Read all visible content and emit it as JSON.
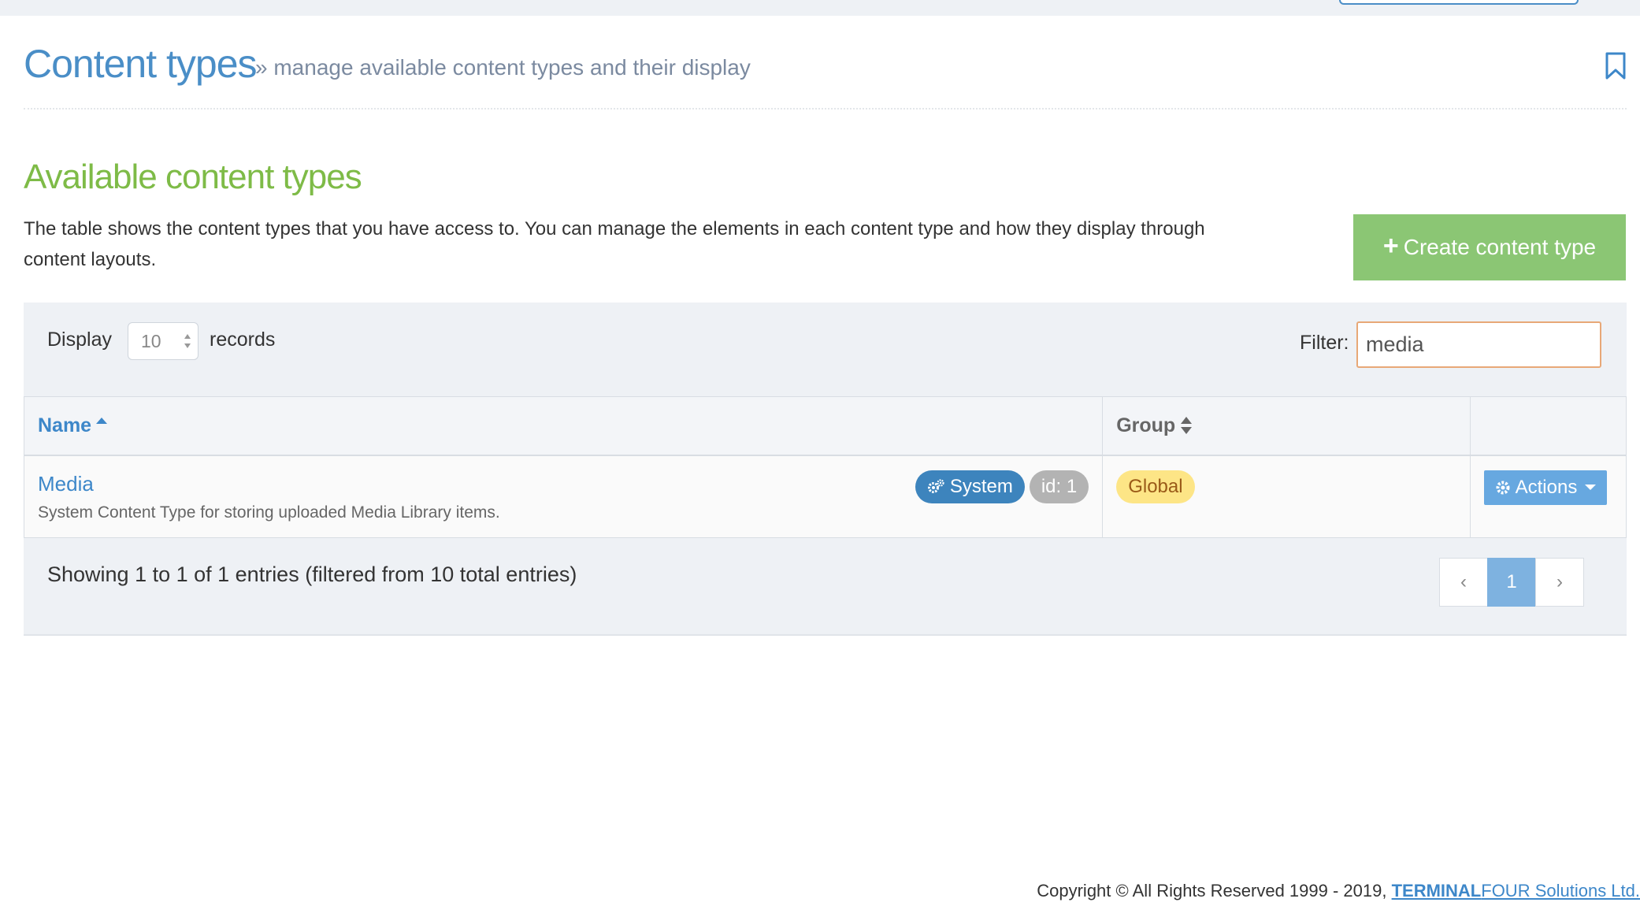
{
  "page": {
    "title": "Content types",
    "subtitle": "» manage available content types and their display",
    "icons": {
      "bookmark": "bookmark-icon"
    }
  },
  "section": {
    "title": "Available content types",
    "description": "The table shows the content types that you have access to. You can manage the elements in each content type and how they display through content layouts.",
    "create_button": "Create content type"
  },
  "table_controls": {
    "display_label": "Display",
    "page_length": "10",
    "records_label": "records",
    "filter_label": "Filter:",
    "filter_value": "media"
  },
  "table": {
    "columns": {
      "name": "Name",
      "group": "Group",
      "actions": ""
    },
    "rows": [
      {
        "name": "Media",
        "description": "System Content Type for storing uploaded Media Library items.",
        "system_badge": "System",
        "id_badge": "id: 1",
        "group": "Global",
        "actions_label": "Actions"
      }
    ]
  },
  "pagination": {
    "info": "Showing 1 to 1 of 1 entries (filtered from 10 total entries)",
    "prev": "‹",
    "current": "1",
    "next": "›"
  },
  "footer": {
    "text": "Copyright © All Rights Reserved 1999 - 2019, ",
    "brand_bold": "TERMINAL",
    "brand_rest": "FOUR Solutions Ltd."
  },
  "colors": {
    "title_blue": "#4a8ec7",
    "section_green": "#7ebb47",
    "create_button": "#8bc674",
    "system_badge": "#3d84bd",
    "id_badge": "#b3b3b3",
    "global_badge": "#fde586",
    "actions_button": "#67a8e0",
    "filter_border": "#e8a877"
  }
}
